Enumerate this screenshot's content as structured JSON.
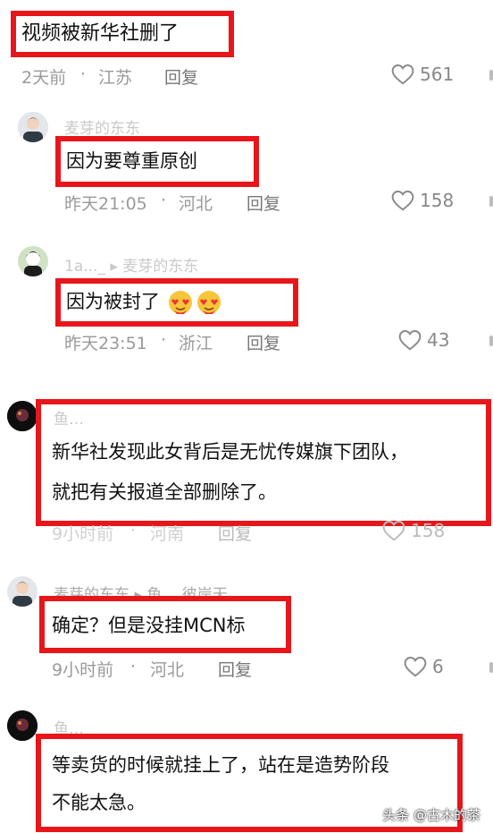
{
  "comments": [
    {
      "username": "",
      "text": "视频被新华社删了",
      "time": "2天前",
      "location": "江苏",
      "reply_label": "回复",
      "likes": "561"
    },
    {
      "username": "麦芽的东东",
      "text": "因为要尊重原创",
      "time": "昨天21:05",
      "location": "河北",
      "reply_label": "回复",
      "likes": "158"
    },
    {
      "username": "1a..._  ▸ 麦芽的东东",
      "text": "因为被封了",
      "emojis": [
        "heart-face-emoji",
        "heart-face-emoji"
      ],
      "time": "昨天23:51",
      "location": "浙江",
      "reply_label": "回复",
      "likes": "43"
    },
    {
      "username": "鱼…",
      "text_line1": "新华社发现此女背后是无忧传媒旗下团队，",
      "text_line2": "就把有关报道全部删除了。",
      "time": "9小时前",
      "location": "河南",
      "reply_label": "回复",
      "likes": "158"
    },
    {
      "username": "麦芽的东东 ▸ 鱼… 彼岸天",
      "text": "确定？但是没挂MCN标",
      "time": "9小时前",
      "location": "河北",
      "reply_label": "回复",
      "likes": "6"
    },
    {
      "username": "鱼…",
      "text_line1": "等卖货的时候就挂上了，站在是造势阶段",
      "text_line2": "不能太急。"
    }
  ],
  "separator": "·",
  "watermark": "头条 @古木的茶",
  "colors": {
    "highlight": "#e8161a",
    "meta": "#9a9a9a"
  },
  "icons": {
    "like": "heart-outline-icon"
  }
}
